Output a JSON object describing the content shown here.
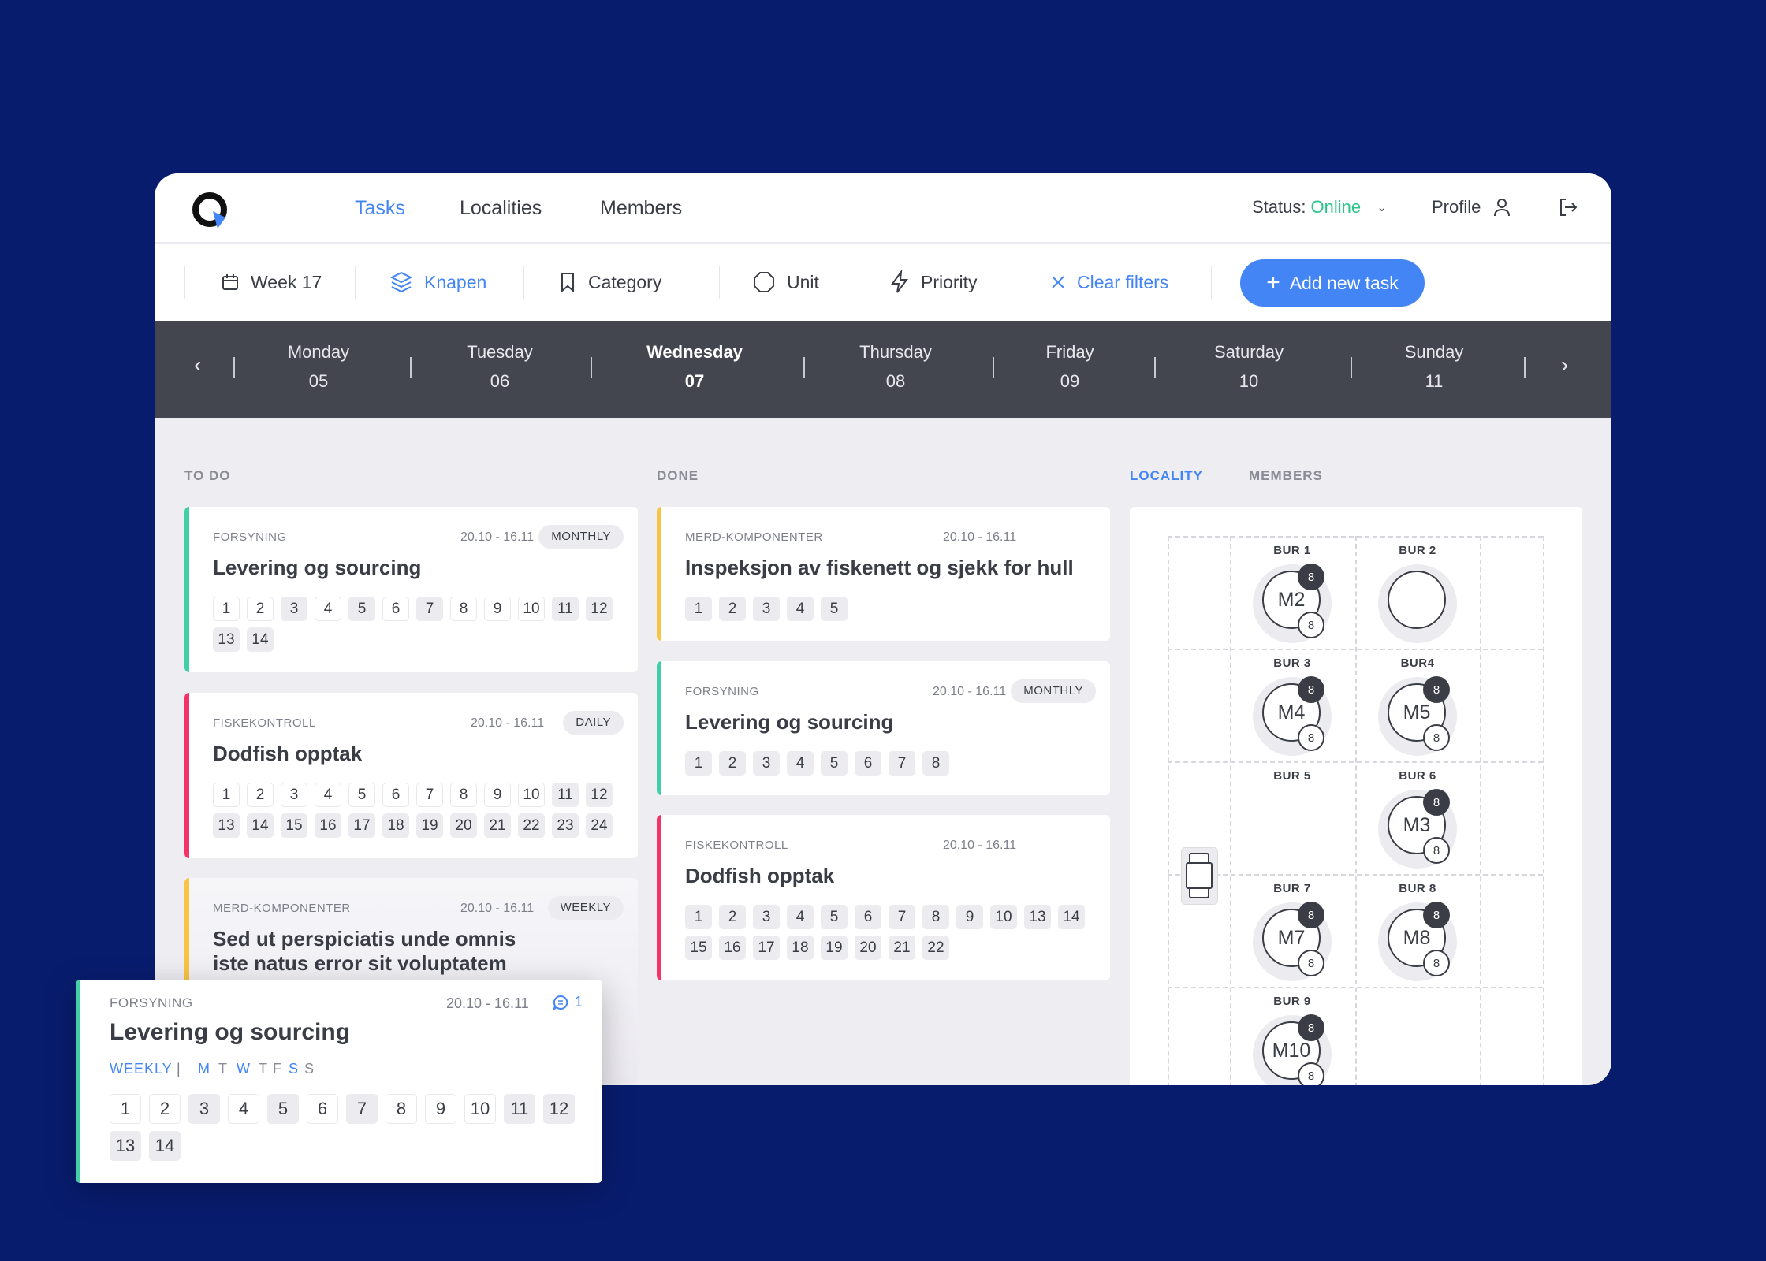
{
  "colors": {
    "background": "#081c6e",
    "accent": "#4385f5",
    "online": "#2bc48a",
    "teal": "#42cfa8",
    "red": "#f5336a",
    "yellow": "#f8c444",
    "dark": "#43464f"
  },
  "nav": {
    "tasks": "Tasks",
    "localities": "Localities",
    "members": "Members"
  },
  "header": {
    "status_label": "Status:",
    "status_value": "Online",
    "profile": "Profile"
  },
  "filters": {
    "week": "Week 17",
    "locality": "Knapen",
    "category": "Category",
    "unit": "Unit",
    "priority": "Priority",
    "clear": "Clear filters",
    "add": "Add new task"
  },
  "days": [
    {
      "name": "Monday",
      "date": "05"
    },
    {
      "name": "Tuesday",
      "date": "06"
    },
    {
      "name": "Wednesday",
      "date": "07",
      "active": true
    },
    {
      "name": "Thursday",
      "date": "08"
    },
    {
      "name": "Friday",
      "date": "09"
    },
    {
      "name": "Saturday",
      "date": "10"
    },
    {
      "name": "Sunday",
      "date": "11"
    }
  ],
  "columns": {
    "todo": "TO DO",
    "done": "DONE",
    "locality": "LOCALITY",
    "members": "MEMBERS"
  },
  "todo": [
    {
      "category": "FORSYNING",
      "date": "20.10 - 16.11",
      "badge": "MONTHLY",
      "title": "Levering og sourcing",
      "color": "#42cfa8",
      "chips": [
        1,
        2,
        3,
        4,
        5,
        6,
        7,
        8,
        9,
        10,
        11,
        12,
        13,
        14
      ],
      "filled": [
        3,
        5,
        7,
        11,
        12,
        13,
        14
      ]
    },
    {
      "category": "FISKEKONTROLL",
      "date": "20.10 - 16.11",
      "badge": "DAILY",
      "title": "Dodfish opptak",
      "color": "#f5336a",
      "chips": [
        1,
        2,
        3,
        4,
        5,
        6,
        7,
        8,
        9,
        10,
        11,
        12,
        13,
        14,
        15,
        16,
        17,
        18,
        19,
        20,
        21,
        22,
        23,
        24
      ],
      "filled": [
        11,
        12,
        13,
        14,
        15,
        16,
        17,
        18,
        19,
        20,
        21,
        22,
        23,
        24
      ]
    },
    {
      "category": "MERD-KOMPONENTER",
      "date": "20.10 - 16.11",
      "badge": "WEEKLY",
      "title": "Sed ut perspiciatis unde omnis iste natus error sit voluptatem",
      "color": "#f8c444",
      "chips": [],
      "filled": []
    }
  ],
  "done": [
    {
      "category": "MERD-KOMPONENTER",
      "date": "20.10 - 16.11",
      "badge": "",
      "title": "Inspeksjon av fiskenett og sjekk for hull",
      "color": "#f8c444",
      "chips": [
        1,
        2,
        3,
        4,
        5
      ],
      "filled": [
        1,
        2,
        3,
        4,
        5
      ]
    },
    {
      "category": "FORSYNING",
      "date": "20.10 - 16.11",
      "badge": "MONTHLY",
      "title": "Levering og sourcing",
      "color": "#42cfa8",
      "chips": [
        1,
        2,
        3,
        4,
        5,
        6,
        7,
        8
      ],
      "filled": [
        1,
        2,
        3,
        4,
        5,
        6,
        7,
        8
      ]
    },
    {
      "category": "FISKEKONTROLL",
      "date": "20.10 - 16.11",
      "badge": "",
      "title": "Dodfish opptak",
      "color": "#f5336a",
      "chips": [
        1,
        2,
        3,
        4,
        5,
        6,
        7,
        8,
        9,
        10,
        13,
        14,
        15,
        16,
        17,
        18,
        19,
        20,
        21,
        22
      ],
      "filled": [
        1,
        2,
        3,
        4,
        5,
        6,
        7,
        8,
        9,
        10,
        13,
        14,
        15,
        16,
        17,
        18,
        19,
        20,
        21,
        22
      ]
    }
  ],
  "floating": {
    "category": "FORSYNING",
    "date": "20.10 - 16.11",
    "comments": "1",
    "title": "Levering og sourcing",
    "frequency": "WEEKLY",
    "separator": "|",
    "weekdays": [
      {
        "l": "M",
        "on": true
      },
      {
        "l": "T",
        "on": false
      },
      {
        "l": "W",
        "on": true
      },
      {
        "l": "T",
        "on": false
      },
      {
        "l": "F",
        "on": false
      },
      {
        "l": "S",
        "on": true
      },
      {
        "l": "S",
        "on": false
      }
    ],
    "chips": [
      1,
      2,
      3,
      4,
      5,
      6,
      7,
      8,
      9,
      10,
      11,
      12,
      13,
      14
    ],
    "filled": [
      3,
      5,
      7,
      11,
      12,
      13,
      14
    ]
  },
  "cages": [
    {
      "label": "BUR 1",
      "unit": "M2",
      "top": "8",
      "bottom": "8"
    },
    {
      "label": "BUR 2",
      "unit": "",
      "empty_ring": true
    },
    {
      "label": "BUR 3",
      "unit": "M4",
      "top": "8",
      "bottom": "8"
    },
    {
      "label": "BUR4",
      "unit": "M5",
      "top": "8",
      "bottom": "8"
    },
    {
      "label": "BUR 5",
      "none": true
    },
    {
      "label": "BUR 6",
      "unit": "M3",
      "top": "8",
      "bottom": "8"
    },
    {
      "label": "BUR 7",
      "unit": "M7",
      "top": "8",
      "bottom": "8"
    },
    {
      "label": "BUR 8",
      "unit": "M8",
      "top": "8",
      "bottom": "8"
    },
    {
      "label": "BUR 9",
      "unit": "M10",
      "top": "8",
      "bottom": "8"
    }
  ]
}
